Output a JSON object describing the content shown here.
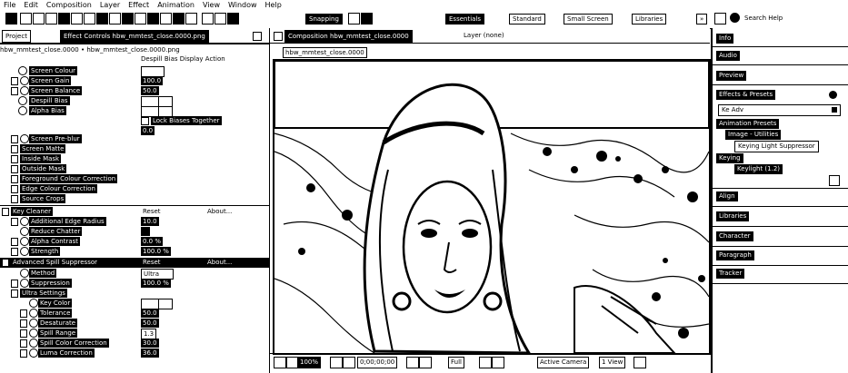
{
  "menubar": [
    "File",
    "Edit",
    "Composition",
    "Layer",
    "Effect",
    "Animation",
    "View",
    "Window",
    "Help"
  ],
  "toolbar": {
    "snapping": "Snapping",
    "workspaces": [
      "Essentials",
      "Standard",
      "Small Screen",
      "Libraries"
    ],
    "overflow": "»",
    "search_placeholder": "Search Help"
  },
  "left": {
    "tab_project": "Project",
    "tab_effect_controls": "Effect Controls hbw_mmtest_close.0000.png",
    "layer_path": "hbw_mmtest_close.0000 • hbw_mmtest_close.0000.png",
    "partial_top": "Despill Bias Display Action",
    "rows": [
      {
        "label": "Screen Colour",
        "value": ""
      },
      {
        "label": "Screen Gain",
        "value": "100.0"
      },
      {
        "label": "Screen Balance",
        "value": "50.0"
      },
      {
        "label": "Despill Bias",
        "value": ""
      },
      {
        "label": "Alpha Bias",
        "value": ""
      },
      {
        "label": "",
        "value": "Lock Biases Together"
      },
      {
        "label": "",
        "value": "0.0"
      },
      {
        "label": "Screen Pre-blur",
        "value": ""
      },
      {
        "label": "Screen Matte",
        "value": ""
      },
      {
        "label": "Inside Mask",
        "value": ""
      },
      {
        "label": "Outside Mask",
        "value": ""
      },
      {
        "label": "Foreground Colour Correction",
        "value": ""
      },
      {
        "label": "Edge Colour Correction",
        "value": ""
      },
      {
        "label": "Source Crops",
        "value": ""
      },
      {
        "label": "Key Cleaner",
        "value": "Reset",
        "extra": "About..."
      },
      {
        "label": "Additional Edge Radius",
        "value": "10.0"
      },
      {
        "label": "Reduce Chatter",
        "value": ""
      },
      {
        "label": "Alpha Contrast",
        "value": "0.0 %"
      },
      {
        "label": "Strength",
        "value": "100.0 %"
      },
      {
        "label": "Advanced Spill Suppressor",
        "value": "Reset",
        "extra": "About..."
      },
      {
        "label": "Method",
        "value": "Ultra"
      },
      {
        "label": "Suppression",
        "value": "100.0 %"
      },
      {
        "label": "Ultra Settings",
        "value": ""
      },
      {
        "label": "Key Color",
        "value": ""
      },
      {
        "label": "Tolerance",
        "value": "50.0"
      },
      {
        "label": "Desaturate",
        "value": "50.0"
      },
      {
        "label": "Spill Range",
        "value": "1.3"
      },
      {
        "label": "Spill Color Correction",
        "value": "30.0"
      },
      {
        "label": "Luma Correction",
        "value": "36.0"
      }
    ]
  },
  "comp": {
    "tab_composition": "Composition hbw_mmtest_close.0000",
    "tab_layer": "Layer (none)",
    "comp_name": "hbw_mmtest_close.0000",
    "footer": {
      "zoom": "100%",
      "timecode": "0;00;00;00",
      "resolution": "Full",
      "camera": "Active Camera",
      "view": "1 View"
    }
  },
  "right": {
    "panels_top": [
      "Info",
      "Audio",
      "Preview",
      "Effects & Presets"
    ],
    "search_value": "Ke Adv",
    "tree": [
      {
        "label": "Animation Presets",
        "level": 0
      },
      {
        "label": "Image - Utilities",
        "level": 1
      },
      {
        "label": "Keying Light Suppressor",
        "level": 2
      },
      {
        "label": "Keying",
        "level": 0
      },
      {
        "label": "Keylight (1.2)",
        "level": 1
      }
    ],
    "panels_bottom": [
      "Align",
      "Libraries",
      "Character",
      "Paragraph",
      "Tracker"
    ]
  }
}
